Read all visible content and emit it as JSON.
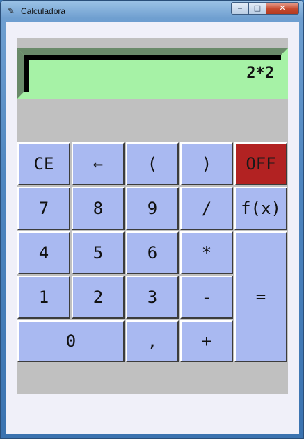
{
  "window": {
    "title": "Calculadora",
    "app_icon": "feather-icon",
    "controls": {
      "minimize": "‒",
      "maximize": "□",
      "close": "✕"
    }
  },
  "display": {
    "text": "2*2"
  },
  "keys": {
    "ce": "CE",
    "backspace": "←",
    "lparen": "(",
    "rparen": ")",
    "off": "OFF",
    "seven": "7",
    "eight": "8",
    "nine": "9",
    "divide": "/",
    "fx": "f(x)",
    "four": "4",
    "five": "5",
    "six": "6",
    "multiply": "*",
    "equals": "=",
    "one": "1",
    "two": "2",
    "three": "3",
    "minus": "-",
    "zero": "0",
    "comma": ",",
    "plus": "+"
  },
  "colors": {
    "key": "#a9b9f1",
    "off_key": "#b22222",
    "display": "#a6f2a6",
    "frame": "#c0c0c0"
  }
}
